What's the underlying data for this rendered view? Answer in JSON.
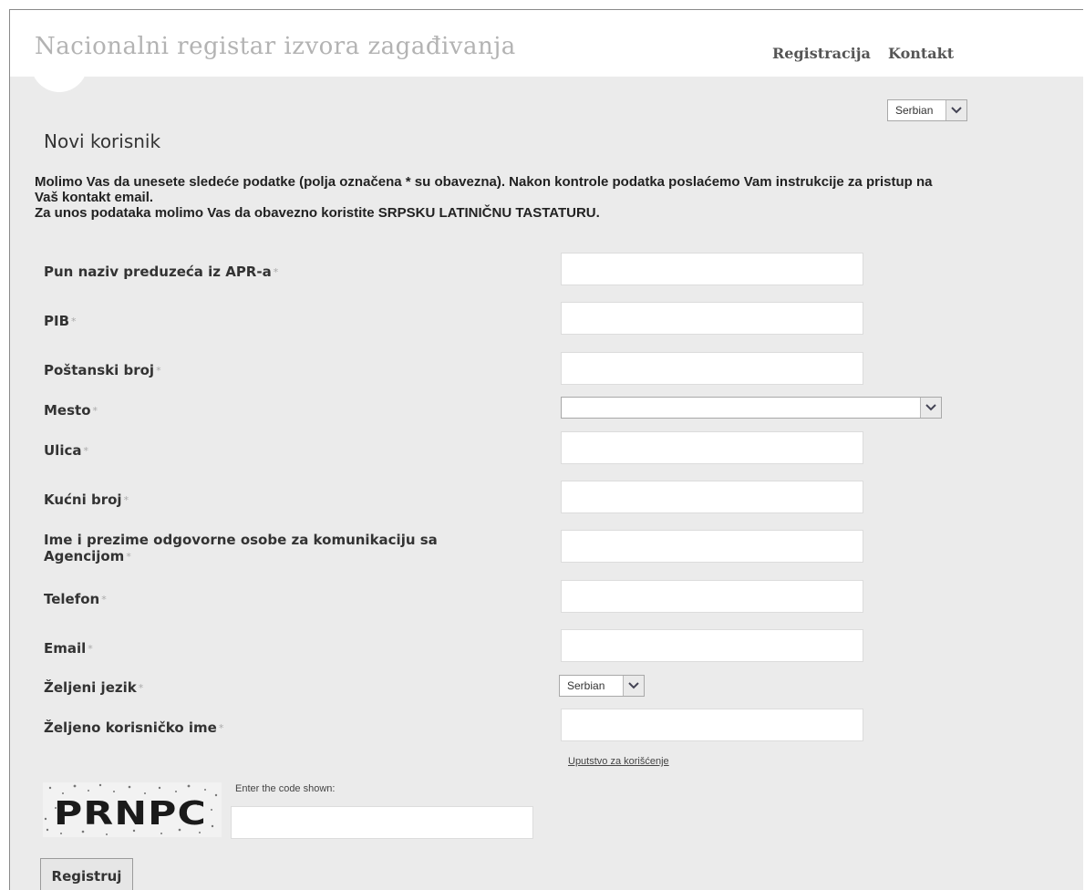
{
  "header": {
    "site_title": "Nacionalni registar izvora zagađivanja",
    "nav": [
      {
        "label": "Registracija"
      },
      {
        "label": "Kontakt"
      }
    ]
  },
  "language_selector": {
    "value": "Serbian"
  },
  "page_heading": "Novi korisnik",
  "intro": {
    "line1": "Molimo Vas da unesete sledeće podatke (polja označena * su obavezna). Nakon kontrole podatka poslaćemo Vam instrukcije za pristup na Vaš kontakt email.",
    "line2": "Za unos podataka molimo Vas da obavezno koristite SRPSKU LATINIČNU TASTATURU."
  },
  "required_marker": "*",
  "form": {
    "company_name": {
      "label": "Pun naziv preduzeća iz APR-a",
      "value": ""
    },
    "pib": {
      "label": "PIB",
      "value": ""
    },
    "postal_code": {
      "label": "Poštanski broj",
      "value": ""
    },
    "city": {
      "label": "Mesto",
      "value": ""
    },
    "street": {
      "label": "Ulica",
      "value": ""
    },
    "house_number": {
      "label": "Kućni broj",
      "value": ""
    },
    "contact_person": {
      "label": "Ime i prezime odgovorne osobe za komunikaciju sa Agencijom",
      "value": ""
    },
    "phone": {
      "label": "Telefon",
      "value": ""
    },
    "email": {
      "label": "Email",
      "value": ""
    },
    "language": {
      "label": "Željeni jezik",
      "value": "Serbian"
    },
    "username": {
      "label": "Željeno korisničko ime",
      "value": ""
    }
  },
  "help_link": "Uputstvo za korišćenje",
  "captcha": {
    "image_text": "PRNPC",
    "prompt": "Enter the code shown:",
    "value": ""
  },
  "submit_label": "Registruj",
  "colors": {
    "page_background": "#ebebeb",
    "header_background": "#ffffff",
    "title_gray": "#b3b3b3",
    "nav_text": "#555555"
  },
  "icons": {
    "dropdown": "chevron-down-icon"
  }
}
